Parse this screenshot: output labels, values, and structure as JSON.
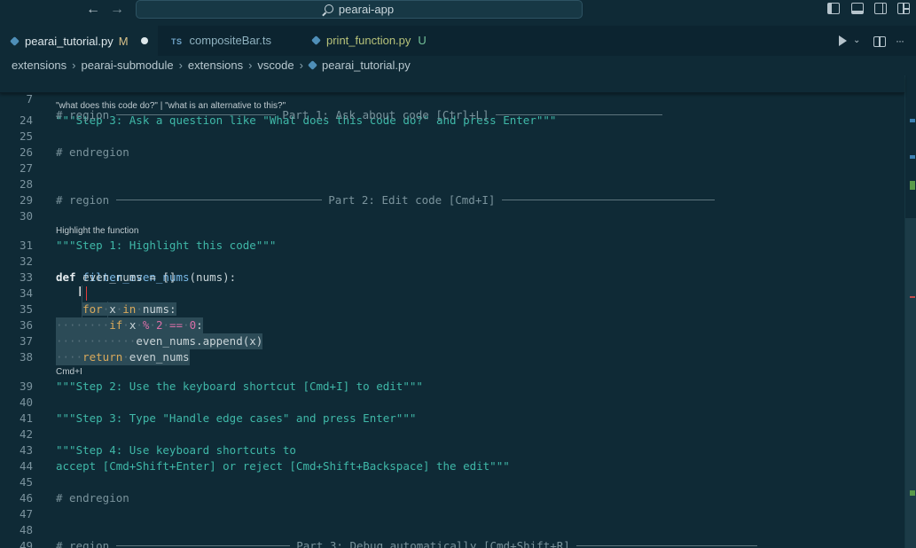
{
  "titlebar": {
    "back_glyph": "←",
    "forward_glyph": "→",
    "search_text": "pearai-app",
    "icons": [
      "arrow-left-icon",
      "arrow-right-icon",
      "search-icon",
      "toggle-primary-sidebar-icon",
      "toggle-panel-icon",
      "toggle-secondary-sidebar-icon",
      "customize-layout-icon"
    ]
  },
  "tabs": [
    {
      "label": "pearai_tutorial.py",
      "flag": "M",
      "icon": "python-icon",
      "active": true,
      "dirty": true
    },
    {
      "label": "compositeBar.ts",
      "icon_text": "TS",
      "icon": "typescript-icon",
      "active": false
    },
    {
      "label": "print_function.py",
      "flag": "U",
      "icon": "python-icon",
      "active": false
    }
  ],
  "tab_actions": {
    "icons": [
      "run-icon",
      "run-dropdown-icon",
      "split-editor-icon",
      "more-actions-icon"
    ],
    "more_glyph": "···"
  },
  "breadcrumb": {
    "items": [
      "extensions",
      "pearai-submodule",
      "extensions",
      "vscode",
      "pearai_tutorial.py"
    ],
    "separator": "›"
  },
  "editor": {
    "sticky": {
      "ln": "7",
      "comment": "# region ",
      "title": " Part 1: Ask about code [Ctrl+L] "
    },
    "partial_ln_top": "25",
    "inlays": {
      "a": "\"what does this code do?\" | \"what is an alternative to this?\"",
      "b": "Highlight the function",
      "c": "Cmd+I"
    },
    "lines": {
      "l24": {
        "ln": "24",
        "text": "\"\"\"Step 3: Ask a question like \"What does this code do?\" and press Enter\"\"\""
      },
      "l25": {
        "ln": "25"
      },
      "l26": {
        "ln": "26",
        "text": "# endregion"
      },
      "l27": {
        "ln": "27"
      },
      "l28": {
        "ln": "28",
        "comment": "# region ",
        "title": " Part 2: Edit code [Cmd+I] "
      },
      "l29": {
        "ln": "29"
      },
      "l30": {
        "ln": "30"
      },
      "l31": {
        "ln": "31",
        "text": "\"\"\"Step 1: Highlight this code\"\"\""
      },
      "l32": {
        "ln": "32",
        "kw": "def",
        "fn": "filter_even_nums",
        "rest": "(nums):"
      },
      "l33": {
        "ln": "33",
        "text": "    even_nums = []"
      },
      "l34": {
        "ln": "34",
        "ws": "    ",
        "kw1": "for",
        "d1": "·",
        "v1": "x",
        "d2": "·",
        "kw2": "in",
        "d3": "·",
        "v2": "nums",
        "p": ":"
      },
      "l35": {
        "ln": "35",
        "ws": "········",
        "kw": "if",
        "d1": "·",
        "v1": "x",
        "d2": "·",
        "op": "%",
        "d3": "·",
        "num": "2",
        "d4": "·",
        "eq": "==",
        "d5": "·",
        "num2": "0",
        "p": ":"
      },
      "l36": {
        "ln": "36",
        "ws": "············",
        "text": "even_nums.append(x)"
      },
      "l37": {
        "ln": "37",
        "ws": "····",
        "kw": "return",
        "d1": "·",
        "text": "even_nums"
      },
      "l38": {
        "ln": "38"
      },
      "l39": {
        "ln": "39",
        "text": "\"\"\"Step 2: Use the keyboard shortcut [Cmd+I] to edit\"\"\""
      },
      "l40": {
        "ln": "40"
      },
      "l41": {
        "ln": "41",
        "text": "\"\"\"Step 3: Type \"Handle edge cases\" and press Enter\"\"\""
      },
      "l42": {
        "ln": "42"
      },
      "l43": {
        "ln": "43",
        "text": "\"\"\"Step 4: Use keyboard shortcuts to"
      },
      "l44": {
        "ln": "44",
        "text": "accept [Cmd+Shift+Enter] or reject [Cmd+Shift+Backspace] the edit\"\"\""
      },
      "l45": {
        "ln": "45"
      },
      "l46": {
        "ln": "46",
        "text": "# endregion"
      },
      "l47": {
        "ln": "47"
      },
      "l48": {
        "ln": "48",
        "comment": "# region ",
        "title": " Part 3: Debug automatically [Cmd+Shift+R] "
      },
      "l49": {
        "ln": "49"
      }
    }
  },
  "colors": {
    "background": "#0f2a36",
    "string": "#3fb8a8",
    "comment": "#7a939c",
    "function": "#79b8e6",
    "operator": "#d86fa7",
    "cursor": "#e03c3c"
  }
}
